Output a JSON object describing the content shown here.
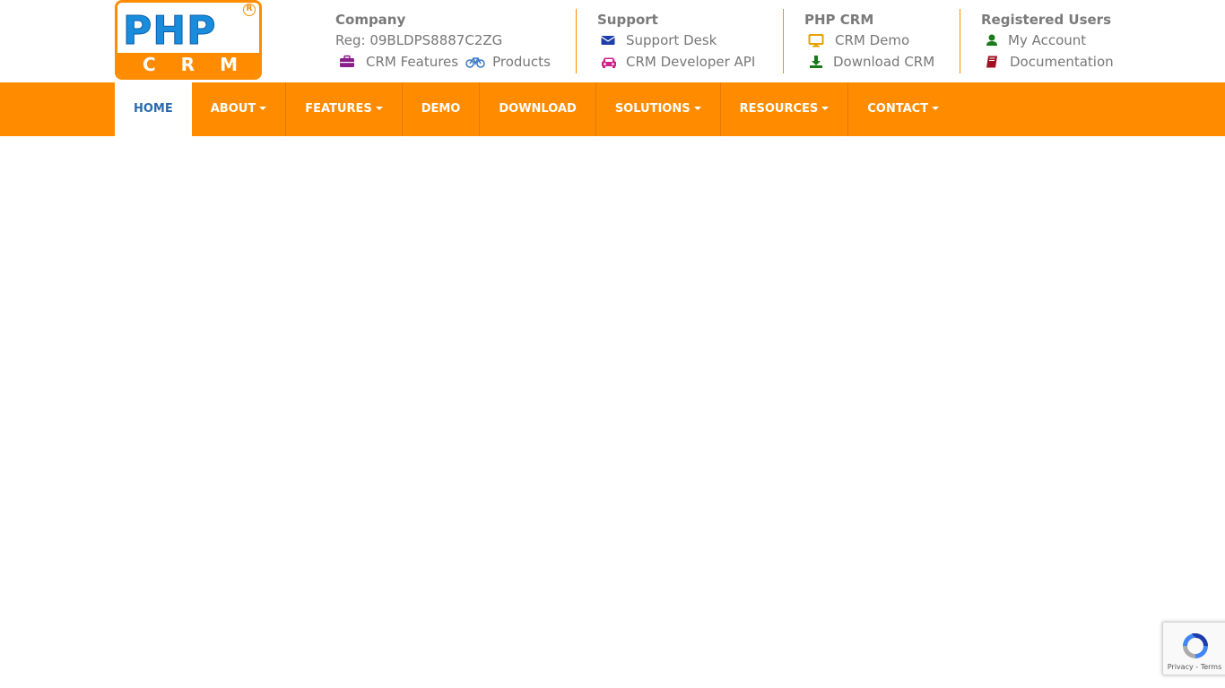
{
  "logo": {
    "top_text": "PHP",
    "bottom_text": "CRM",
    "registered_mark": "R"
  },
  "header": {
    "company": {
      "title": "Company",
      "reg": "Reg: 09BLDPS8887C2ZG",
      "links": [
        {
          "label": "CRM Features",
          "icon": "briefcase-icon",
          "color": "#8a1f8a"
        },
        {
          "label": "Products",
          "icon": "bicycle-icon",
          "color": "#3a78c8"
        }
      ]
    },
    "support": {
      "title": "Support",
      "links": [
        {
          "label": "Support Desk",
          "icon": "envelope-icon",
          "color": "#1f3fa8"
        },
        {
          "label": "CRM Developer API",
          "icon": "car-icon",
          "color": "#d0218a"
        }
      ]
    },
    "phpcrm": {
      "title": "PHP CRM",
      "links": [
        {
          "label": "CRM Demo",
          "icon": "desktop-icon",
          "color": "#e8a000"
        },
        {
          "label": "Download CRM",
          "icon": "download-icon",
          "color": "#1a7a1a"
        }
      ]
    },
    "registered": {
      "title": "Registered Users",
      "links": [
        {
          "label": "My Account",
          "icon": "user-icon",
          "color": "#1a7a1a"
        },
        {
          "label": "Documentation",
          "icon": "book-icon",
          "color": "#a01020"
        }
      ]
    }
  },
  "nav": {
    "items": [
      {
        "label": "HOME",
        "dropdown": false,
        "active": true
      },
      {
        "label": "ABOUT",
        "dropdown": true,
        "active": false
      },
      {
        "label": "FEATURES",
        "dropdown": true,
        "active": false
      },
      {
        "label": "DEMO",
        "dropdown": false,
        "active": false
      },
      {
        "label": "DOWNLOAD",
        "dropdown": false,
        "active": false
      },
      {
        "label": "SOLUTIONS",
        "dropdown": true,
        "active": false
      },
      {
        "label": "RESOURCES",
        "dropdown": true,
        "active": false
      },
      {
        "label": "CONTACT",
        "dropdown": true,
        "active": false
      }
    ],
    "bg_color": "#ff8c00",
    "active_text_color": "#2a6ab0"
  },
  "recaptcha": {
    "privacy": "Privacy",
    "separator": " - ",
    "terms": "Terms"
  }
}
